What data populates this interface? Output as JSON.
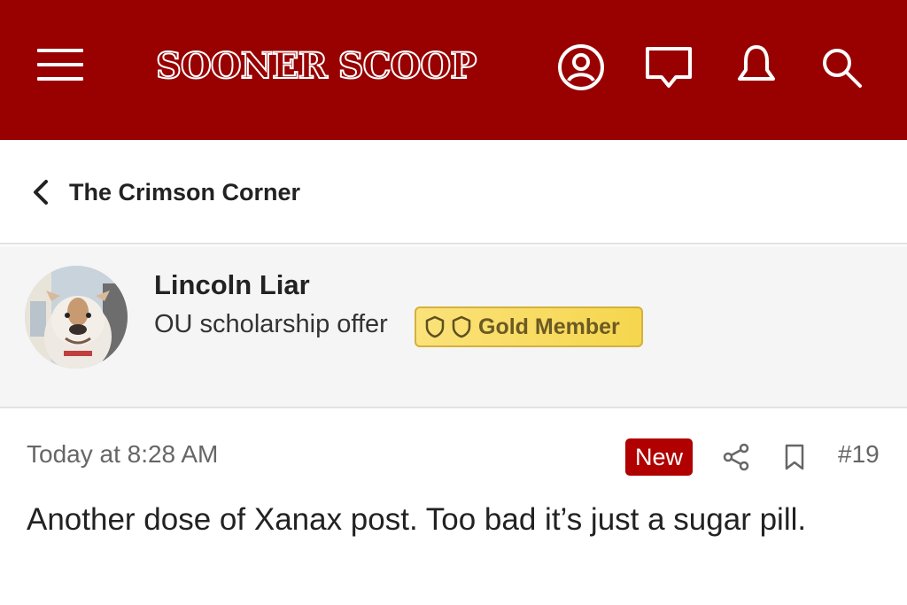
{
  "header": {
    "logo_text": "SOONER SCOOP",
    "colors": {
      "background": "#990000",
      "icons": "#ffffff"
    },
    "icons": [
      "hamburger-menu-icon",
      "profile-icon",
      "chat-icon",
      "bell-icon",
      "search-icon"
    ]
  },
  "breadcrumb": {
    "back_icon": "chevron-left-icon",
    "label": "The Crimson Corner"
  },
  "author": {
    "name": "Lincoln Liar",
    "title": "OU scholarship offer",
    "badge": {
      "label": "Gold Member",
      "icons": [
        "shield-icon",
        "shield-icon"
      ],
      "color": "#f6d64e"
    }
  },
  "post": {
    "timestamp": "Today at 8:28 AM",
    "new_label": "New",
    "new_color": "#b00000",
    "number": "#19",
    "body": "Another dose of Xanax post. Too bad it’s just a sugar pill."
  }
}
